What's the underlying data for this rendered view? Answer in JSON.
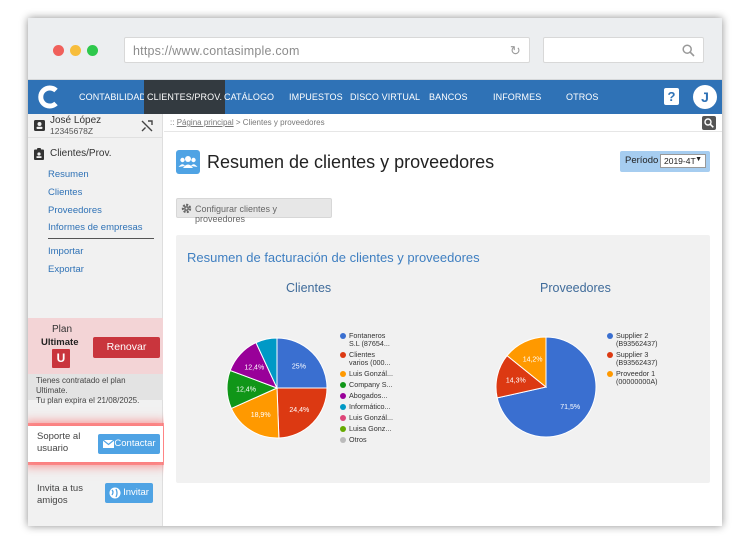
{
  "browser": {
    "url": "https://www.contasimple.com"
  },
  "nav": {
    "items": [
      "CONTABILIDAD",
      "CLIENTES/PROV.",
      "CATÁLOGO",
      "IMPUESTOS",
      "DISCO VIRTUAL",
      "BANCOS",
      "INFORMES",
      "OTROS"
    ],
    "active": "CLIENTES/PROV.",
    "help_label": "?",
    "avatar_letter": "J",
    "logo_letter": "C"
  },
  "sidebar": {
    "user_name": "José López",
    "user_id": "12345678Z",
    "section_title": "Clientes/Prov.",
    "links_group1": [
      "Resumen",
      "Clientes",
      "Proveedores",
      "Informes de empresas"
    ],
    "links_group2": [
      "Importar",
      "Exportar"
    ],
    "plan_label": "Plan",
    "plan_name": "Ultimate",
    "plan_badge": "U",
    "renew_label": "Renovar",
    "plan_info_1": "Tienes contratado el plan Ultimate.",
    "plan_info_2": "Tu plan expira el 21/08/2025.",
    "support_1": "Soporte al",
    "support_2": "usuario",
    "contact_label": "Contactar",
    "invite_1": "Invita a tus",
    "invite_2": "amigos",
    "invite_label": "Invitar"
  },
  "breadcrumb": {
    "prefix": "::",
    "home": "Página principal",
    "separator": ">",
    "current": "Clientes y proveedores"
  },
  "page": {
    "title": "Resumen de clientes y proveedores",
    "period_label": "Período",
    "period_value": "2019-4T",
    "config_label": "Configurar clientes y proveedores",
    "panel_title": "Resumen de facturación de clientes y proveedores"
  },
  "colors": {
    "brand_blue": "#2f72b6",
    "renew_red": "#c9353d"
  },
  "chart_data": [
    {
      "type": "pie",
      "title": "Clientes",
      "slices": [
        {
          "label": "Fontaneros S.L (87654...",
          "value": 25,
          "value_label": "25%",
          "color": "#3a6fd0"
        },
        {
          "label": "Clientes varios (000...",
          "value": 24.4,
          "value_label": "24,4%",
          "color": "#dc3912"
        },
        {
          "label": "Luis Gonzál...",
          "value": 18.9,
          "value_label": "18,9%",
          "color": "#ff9900"
        },
        {
          "label": "Company S...",
          "value": 12.4,
          "value_label": "12,4%",
          "color": "#109618"
        },
        {
          "label": "Abogados...",
          "value": 12.4,
          "value_label": "12,4%",
          "color": "#990099"
        },
        {
          "label": "Informático...",
          "value": 6.9,
          "value_label": "",
          "color": "#0099c6"
        },
        {
          "label": "Luis Gonzál...",
          "value": 0,
          "value_label": "",
          "color": "#dd4477"
        },
        {
          "label": "Luisa Gonz...",
          "value": 0,
          "value_label": "",
          "color": "#66aa00"
        },
        {
          "label": "Otros",
          "value": 0,
          "value_label": "",
          "color": "#bbbbbb"
        }
      ]
    },
    {
      "type": "pie",
      "title": "Proveedores",
      "slices": [
        {
          "label": "Supplier 2 (B93562437)",
          "value": 71.5,
          "value_label": "71,5%",
          "color": "#3a6fd0"
        },
        {
          "label": "Supplier 3 (B93562437)",
          "value": 14.3,
          "value_label": "14,3%",
          "color": "#dc3912"
        },
        {
          "label": "Proveedor 1 (00000000A)",
          "value": 14.2,
          "value_label": "14,2%",
          "color": "#ff9900"
        }
      ]
    }
  ]
}
